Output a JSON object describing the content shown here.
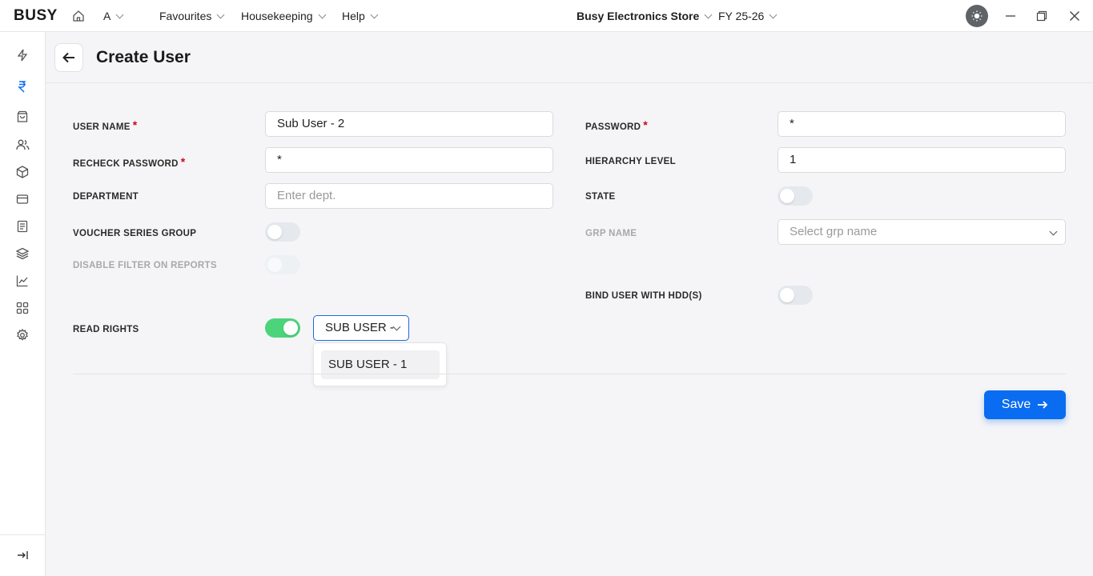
{
  "app": {
    "logo": "BUSY"
  },
  "topbar": {
    "user": "A",
    "menus": [
      "Favourites",
      "Housekeeping",
      "Help"
    ],
    "company": "Busy Electronics Store",
    "fiscal_year": "FY 25-26"
  },
  "page": {
    "title": "Create User"
  },
  "form": {
    "user_name": {
      "label": "USER NAME",
      "value": "Sub User - 2",
      "required": "*"
    },
    "password": {
      "label": "PASSWORD",
      "value": "*",
      "required": "*"
    },
    "recheck_password": {
      "label": "RECHECK PASSWORD",
      "value": "*",
      "required": "*"
    },
    "hierarchy_level": {
      "label": "HIERARCHY LEVEL",
      "value": "1"
    },
    "department": {
      "label": "DEPARTMENT",
      "placeholder": "Enter dept."
    },
    "state": {
      "label": "STATE",
      "on": false
    },
    "voucher_series_group": {
      "label": "VOUCHER SERIES GROUP",
      "on": false
    },
    "grp_name": {
      "label": "GRP NAME",
      "placeholder": "Select grp name"
    },
    "disable_filter": {
      "label": "DISABLE FILTER ON REPORTS",
      "on": false
    },
    "bind_user_hdd": {
      "label": "BIND USER WITH HDD(S)",
      "on": false
    },
    "read_rights": {
      "label": "READ RIGHTS",
      "on": true,
      "selected": "SUB USER - ",
      "options": [
        "SUB USER - 1"
      ]
    }
  },
  "actions": {
    "save_label": "Save"
  },
  "colors": {
    "accent": "#0a6cf0",
    "toggle_on": "#4cd47a",
    "required": "#d0021b"
  }
}
